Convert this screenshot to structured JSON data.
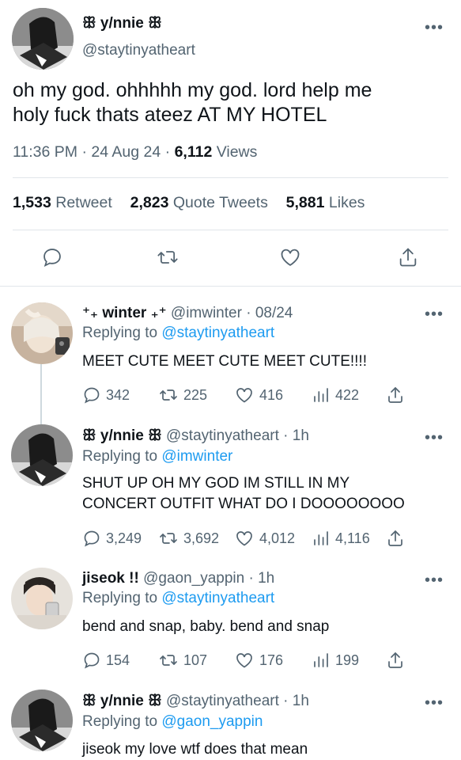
{
  "main_tweet": {
    "display_name": "ꕥ y/nnie ꕥ",
    "handle": "@staytinyatheart",
    "text_line1": "oh my god. ohhhhh my god. lord help me",
    "text_line2": "holy fuck thats ateez AT MY HOTEL",
    "time": "11:36 PM",
    "date": "24 Aug 24",
    "views_count": "6,112",
    "views_label": "Views",
    "sep": "·",
    "stats": {
      "retweets_count": "1,533",
      "retweets_label": "Retweet",
      "quotes_count": "2,823",
      "quotes_label": "Quote Tweets",
      "likes_count": "5,881",
      "likes_label": "Likes"
    }
  },
  "more_glyph": "•••",
  "replying_label": "Replying to",
  "replies": [
    {
      "display_name": "⁺₊ winter ₊⁺",
      "handle": "@imwinter",
      "time": "· 08/24",
      "replying_to": "@staytinyatheart",
      "text": "MEET CUTE MEET CUTE MEET CUTE!!!!",
      "reply_count": "342",
      "retweet_count": "225",
      "like_count": "416",
      "view_count": "422"
    },
    {
      "display_name": "ꕥ y/nnie ꕥ",
      "handle": "@staytinyatheart",
      "time": "· 1h",
      "replying_to": "@imwinter",
      "text_line1": "SHUT UP OH MY GOD IM STILL IN MY",
      "text_line2": "CONCERT OUTFIT WHAT DO I DOOOOOOOO",
      "reply_count": "3,249",
      "retweet_count": "3,692",
      "like_count": "4,012",
      "view_count": "4,116"
    },
    {
      "display_name": "jiseok !!",
      "handle": "@gaon_yappin",
      "time": "· 1h",
      "replying_to": "@staytinyatheart",
      "text": "bend and snap, baby. bend and snap",
      "reply_count": "154",
      "retweet_count": "107",
      "like_count": "176",
      "view_count": "199"
    },
    {
      "display_name": "ꕥ y/nnie ꕥ",
      "handle": "@staytinyatheart",
      "time": "· 1h",
      "replying_to": "@gaon_yappin",
      "text": "jiseok my love wtf does that mean"
    }
  ],
  "colors": {
    "link": "#1d9bf0",
    "secondary": "#536471",
    "primary": "#0f1419",
    "divider": "#e1e6ea"
  }
}
